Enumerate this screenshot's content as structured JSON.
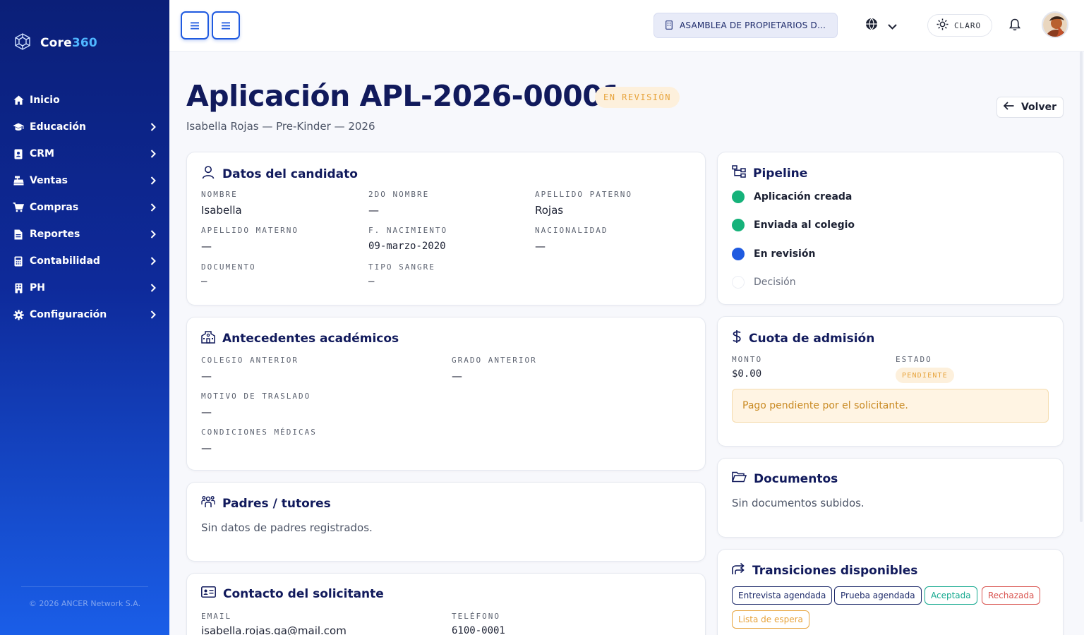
{
  "brand": {
    "name_part1": "Core",
    "name_part2": "360"
  },
  "sidebar": {
    "items": [
      {
        "label": "Inicio",
        "icon": "home-icon",
        "has_children": false
      },
      {
        "label": "Educación",
        "icon": "graduation-cap-icon",
        "has_children": true
      },
      {
        "label": "CRM",
        "icon": "address-book-icon",
        "has_children": true
      },
      {
        "label": "Ventas",
        "icon": "cash-register-icon",
        "has_children": true
      },
      {
        "label": "Compras",
        "icon": "shopping-cart-icon",
        "has_children": true
      },
      {
        "label": "Reportes",
        "icon": "file-report-icon",
        "has_children": true
      },
      {
        "label": "Contabilidad",
        "icon": "calculator-icon",
        "has_children": true
      },
      {
        "label": "PH",
        "icon": "building-icon",
        "has_children": true
      },
      {
        "label": "Configuración",
        "icon": "gear-icon",
        "has_children": true
      }
    ],
    "footer": "© 2026 ANCER Network S.A."
  },
  "topbar": {
    "org_selector": "ASAMBLEA DE PROPIETARIOS DE ...",
    "theme_label": "CLARO",
    "accent_color": "#1f5ae0"
  },
  "header": {
    "title": "Aplicación APL-2026-00001",
    "status": "EN REVISIÓN",
    "subtitle": "Isabella Rojas — Pre-Kinder — 2026",
    "back_label": "Volver"
  },
  "candidate": {
    "title": "Datos del candidato",
    "fields": [
      {
        "label": "NOMBRE",
        "value": "Isabella"
      },
      {
        "label": "2DO NOMBRE",
        "value": "—"
      },
      {
        "label": "APELLIDO PATERNO",
        "value": "Rojas"
      },
      {
        "label": "APELLIDO MATERNO",
        "value": "—"
      },
      {
        "label": "F. NACIMIENTO",
        "value": "09-marzo-2020"
      },
      {
        "label": "NACIONALIDAD",
        "value": "—"
      },
      {
        "label": "DOCUMENTO",
        "value": "–"
      },
      {
        "label": "TIPO SANGRE",
        "value": "–"
      }
    ]
  },
  "academic": {
    "title": "Antecedentes académicos",
    "fields": [
      {
        "label": "COLEGIO ANTERIOR",
        "value": "—"
      },
      {
        "label": "GRADO ANTERIOR",
        "value": "—"
      },
      {
        "label": "MOTIVO DE TRASLADO",
        "value": "—"
      },
      {
        "label": "CONDICIONES MÉDICAS",
        "value": "—"
      }
    ]
  },
  "parents": {
    "title": "Padres / tutores",
    "empty": "Sin datos de padres registrados."
  },
  "contact": {
    "title": "Contacto del solicitante",
    "fields": [
      {
        "label": "EMAIL",
        "value": "isabella.rojas.ga@mail.com"
      },
      {
        "label": "TELÉFONO",
        "value": "6100-0001"
      }
    ]
  },
  "pipeline": {
    "title": "Pipeline",
    "steps": [
      {
        "label": "Aplicación creada",
        "state": "done",
        "color": "#16b27a"
      },
      {
        "label": "Enviada al colegio",
        "state": "done",
        "color": "#16b27a"
      },
      {
        "label": "En revisión",
        "state": "current",
        "color": "#1f5ae0"
      },
      {
        "label": "Decisión",
        "state": "pending",
        "color": "#ffffff"
      }
    ]
  },
  "fee": {
    "title": "Cuota de admisión",
    "amount_label": "MONTO",
    "amount": "$0.00",
    "status_label": "ESTADO",
    "status": "PENDIENTE",
    "alert": "Pago pendiente por el solicitante."
  },
  "documents": {
    "title": "Documentos",
    "empty": "Sin documentos subidos."
  },
  "transitions": {
    "title": "Transiciones disponibles",
    "options": [
      {
        "label": "Entrevista agendada",
        "color": "#1d2a6a"
      },
      {
        "label": "Prueba agendada",
        "color": "#1d2a6a"
      },
      {
        "label": "Aceptada",
        "color": "#13a88e"
      },
      {
        "label": "Rechazada",
        "color": "#d9534f"
      },
      {
        "label": "Lista de espera",
        "color": "#e7a33b"
      }
    ]
  }
}
